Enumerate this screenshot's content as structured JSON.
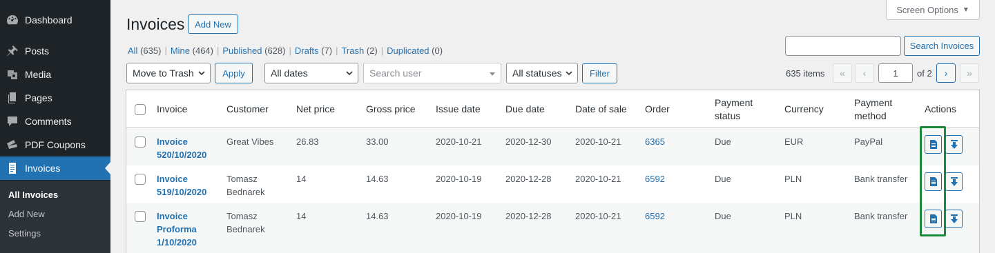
{
  "sidebar": {
    "items": [
      {
        "label": "Dashboard",
        "icon": "dashboard-icon"
      },
      {
        "label": "Posts",
        "icon": "pin-icon"
      },
      {
        "label": "Media",
        "icon": "media-icon"
      },
      {
        "label": "Pages",
        "icon": "pages-icon"
      },
      {
        "label": "Comments",
        "icon": "comment-icon"
      },
      {
        "label": "PDF Coupons",
        "icon": "tickets-icon"
      },
      {
        "label": "Invoices",
        "icon": "invoice-icon"
      }
    ],
    "submenu": [
      "All Invoices",
      "Add New",
      "Settings"
    ]
  },
  "header": {
    "title": "Invoices",
    "add_new": "Add New",
    "screen_options": "Screen Options"
  },
  "views": [
    {
      "label": "All",
      "count": "(635)"
    },
    {
      "label": "Mine",
      "count": "(464)"
    },
    {
      "label": "Published",
      "count": "(628)"
    },
    {
      "label": "Drafts",
      "count": "(7)"
    },
    {
      "label": "Trash",
      "count": "(2)"
    },
    {
      "label": "Duplicated",
      "count": "(0)"
    }
  ],
  "search": {
    "value": "",
    "button": "Search Invoices"
  },
  "filters": {
    "bulk_action": "Move to Trash",
    "apply": "Apply",
    "dates": "All dates",
    "user_placeholder": "Search user",
    "statuses": "All statuses",
    "filter": "Filter"
  },
  "pagination": {
    "items": "635 items",
    "first": "«",
    "prev": "‹",
    "current": "1",
    "of": "of 2",
    "next": "›",
    "last": "»"
  },
  "table": {
    "columns": [
      "Invoice",
      "Customer",
      "Net price",
      "Gross price",
      "Issue date",
      "Due date",
      "Date of sale",
      "Order",
      "Payment status",
      "Currency",
      "Payment method",
      "Actions"
    ],
    "rows": [
      {
        "invoice": "Invoice 520/10/2020",
        "customer": "Great Vibes",
        "net": "26.83",
        "gross": "33.00",
        "issue": "2020-10-21",
        "due": "2020-12-30",
        "sale": "2020-10-21",
        "order": "6365",
        "status": "Due",
        "currency": "EUR",
        "method": "PayPal"
      },
      {
        "invoice": "Invoice 519/10/2020",
        "customer": "Tomasz Bednarek",
        "net": "14",
        "gross": "14.63",
        "issue": "2020-10-19",
        "due": "2020-12-28",
        "sale": "2020-10-21",
        "order": "6592",
        "status": "Due",
        "currency": "PLN",
        "method": "Bank transfer"
      },
      {
        "invoice": "Invoice Proforma 1/10/2020",
        "customer": "Tomasz Bednarek",
        "net": "14",
        "gross": "14.63",
        "issue": "2020-10-19",
        "due": "2020-12-28",
        "sale": "2020-10-21",
        "order": "6592",
        "status": "Due",
        "currency": "PLN",
        "method": "Bank transfer"
      }
    ]
  },
  "colors": {
    "accent": "#2271b1",
    "sidebar_bg": "#1d2327",
    "highlight": "#1a8a3a"
  }
}
